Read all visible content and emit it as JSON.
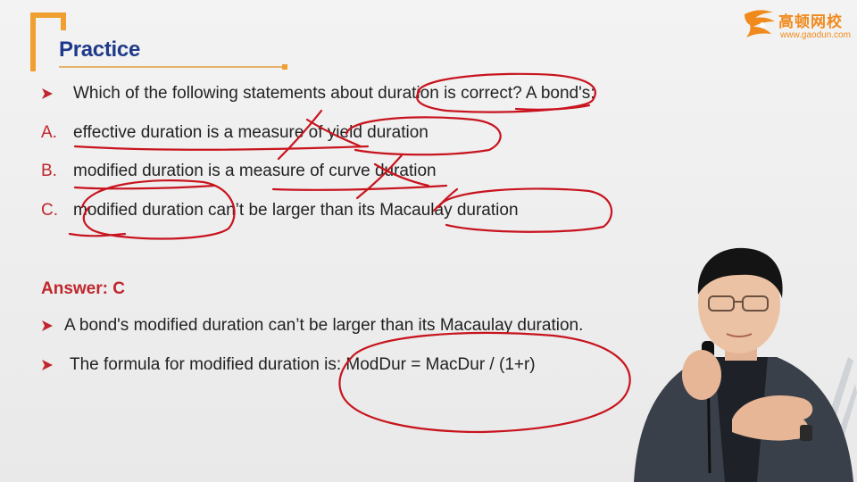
{
  "slide": {
    "title": "Practice",
    "question": "Which of the following statements about duration is correct? A bond's:",
    "options": [
      {
        "letter": "A.",
        "text": "effective duration is a measure of yield duration"
      },
      {
        "letter": "B.",
        "text": "modified duration is a measure of curve duration"
      },
      {
        "letter": "C.",
        "text": "modified duration can’t be larger than its Macaulay duration"
      }
    ],
    "answer_label": "Answer: C",
    "explanations": [
      "A bond's modified duration can’t be larger than its Macaulay duration.",
      "The formula for modified duration is: ModDur = MacDur / (1+r)"
    ]
  },
  "logo": {
    "brand_cn": "高顿网校",
    "url": "www.gaodun.com"
  },
  "colors": {
    "title_blue": "#1f3a8a",
    "accent_orange": "#f0a030",
    "option_red": "#c0262c",
    "ink_red": "#c8141e",
    "logo_orange": "#f08a1c"
  },
  "icons": {
    "bullet": "triangle-arrow-icon",
    "logo": "gaodun-logo-icon",
    "presenter": "presenter-video-icon"
  }
}
